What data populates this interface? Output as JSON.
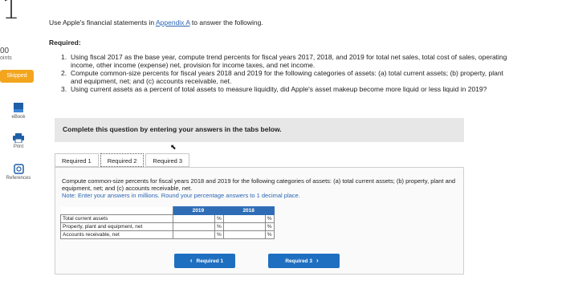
{
  "sidebar": {
    "question_number": "1",
    "points_value": "00",
    "points_label": "oints",
    "status_badge": "Skipped",
    "tools": [
      {
        "icon": "ebook-icon",
        "label": "eBook"
      },
      {
        "icon": "print-icon",
        "label": "Print"
      },
      {
        "icon": "references-icon",
        "label": "References"
      }
    ]
  },
  "instructions": {
    "prefix": "Use Apple's financial statements in ",
    "link": "Appendix A",
    "suffix": " to answer the following."
  },
  "required": {
    "title": "Required:",
    "items": [
      {
        "num": "1.",
        "text": "Using fiscal 2017 as the base year, compute trend percents for fiscal years 2017, 2018, and 2019 for total net sales, total cost of sales, operating income, other income (expense) net, provision for income taxes, and net income."
      },
      {
        "num": "2.",
        "text": "Compute common-size percents for fiscal years 2018 and 2019 for the following categories of assets: (a) total current assets; (b) property, plant and equipment, net; and (c) accounts receivable, net."
      },
      {
        "num": "3.",
        "text": "Using current assets as a percent of total assets to measure liquidity, did Apple's asset makeup become more liquid or less liquid in 2019?"
      }
    ]
  },
  "banner": "Complete this question by entering your answers in the tabs below.",
  "tabs": [
    "Required 1",
    "Required 2",
    "Required 3"
  ],
  "active_tab": 1,
  "panel": {
    "description": "Compute common-size percents for fiscal years 2018 and 2019 for the following categories of assets: (a) total current assets; (b) property, plant and equipment, net; and (c) accounts receivable, net.",
    "note": "Note: Enter your answers in millions. Round your percentage answers to 1 decimal place.",
    "table": {
      "col_headers": [
        "2019",
        "2018"
      ],
      "rows": [
        {
          "label": "Total current assets",
          "v2019": "",
          "v2018": ""
        },
        {
          "label": "Property, plant and equipment, net",
          "v2019": "",
          "v2018": ""
        },
        {
          "label": "Accounts receivable, net",
          "v2019": "",
          "v2018": ""
        }
      ],
      "pct_symbol": "%"
    },
    "prev_button": "Required 1",
    "next_button": "Required 3"
  }
}
